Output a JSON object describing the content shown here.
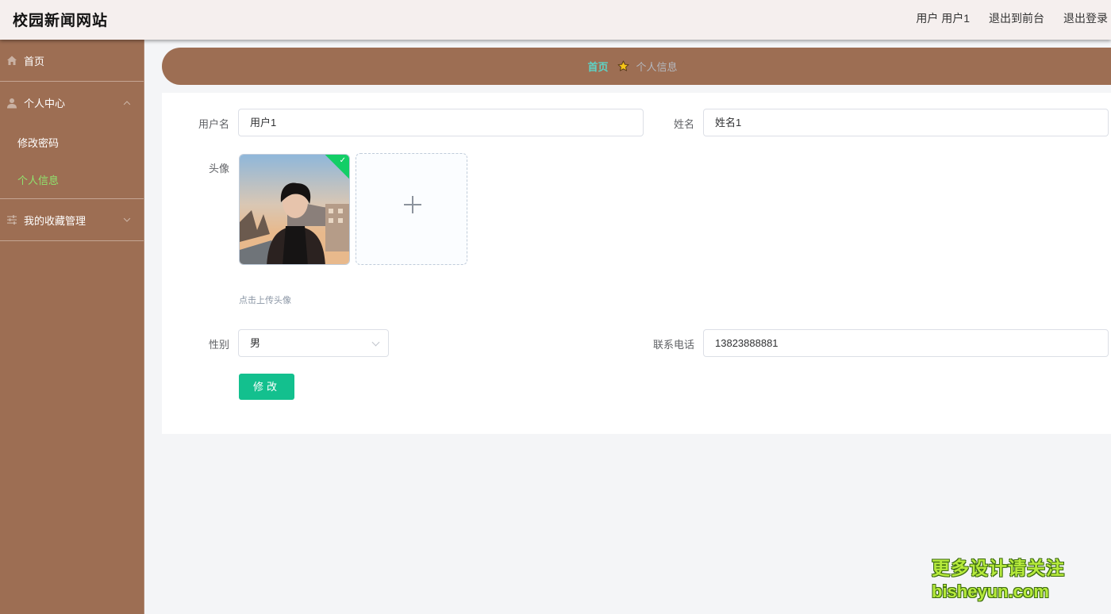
{
  "header": {
    "site_title": "校园新闻网站",
    "user_label": "用户 用户1",
    "back_to_front": "退出到前台",
    "logout": "退出登录"
  },
  "sidebar": {
    "home": {
      "label": "首页",
      "icon": "home-icon"
    },
    "personal_center": {
      "label": "个人中心",
      "icon": "user-icon",
      "items": [
        {
          "label": "修改密码"
        },
        {
          "label": "个人信息",
          "active": true
        }
      ]
    },
    "favorites": {
      "label": "我的收藏管理",
      "icon": "sliders-icon"
    }
  },
  "breadcrumb": {
    "home": "首页",
    "current": "个人信息",
    "separator_icon": "star-icon"
  },
  "form": {
    "username_label": "用户名",
    "username_value": "用户1",
    "name_label": "姓名",
    "name_value": "姓名1",
    "avatar_label": "头像",
    "upload_hint": "点击上传头像",
    "gender_label": "性别",
    "gender_value": "男",
    "phone_label": "联系电话",
    "phone_value": "13823888881",
    "submit_label": "修改"
  },
  "watermark": {
    "line1": "更多设计请关注",
    "line2": "bisheyun.com"
  },
  "colors": {
    "sidebar_bg": "#9d6e53",
    "header_bg": "#f5efee",
    "active_menu": "#8fe46e",
    "breadcrumb_home": "#5ed3c6",
    "button": "#13c08e"
  }
}
